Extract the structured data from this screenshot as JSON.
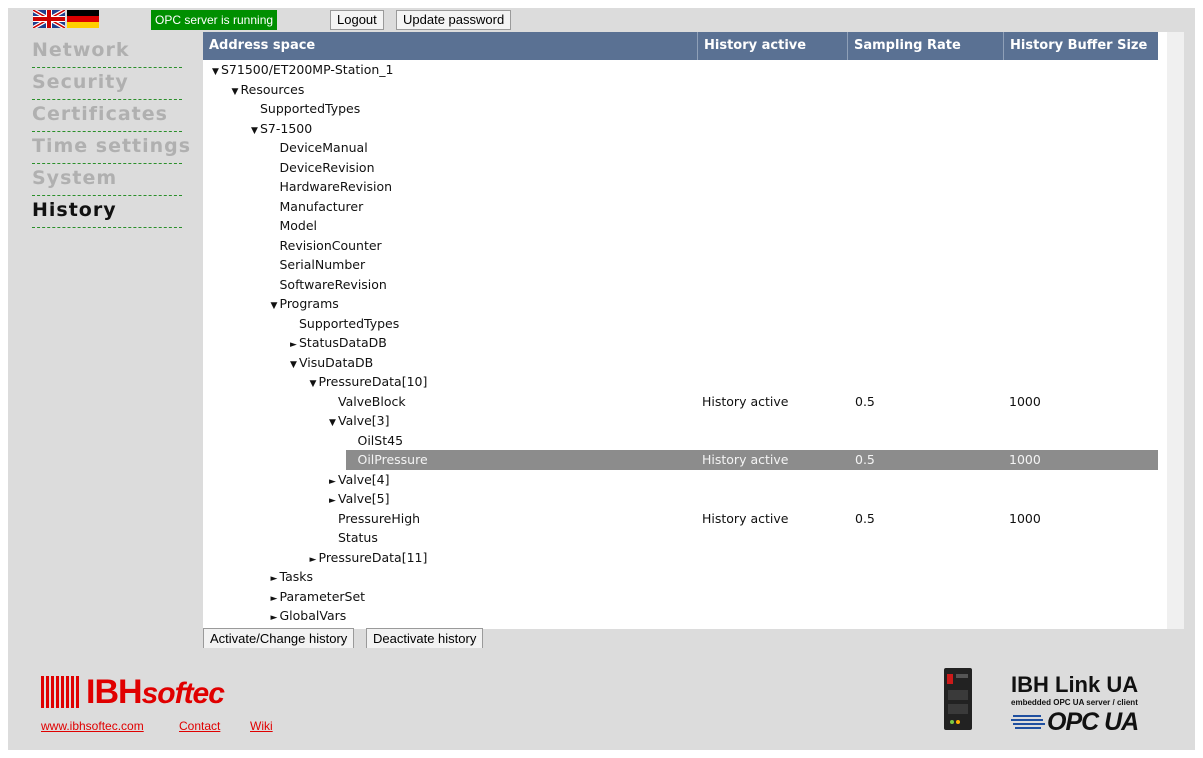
{
  "topbar": {
    "status": "OPC server is running",
    "logout_label": "Logout",
    "update_password_label": "Update password",
    "flags": [
      "uk-flag",
      "germany-flag"
    ]
  },
  "nav": {
    "items": [
      {
        "label": "Network",
        "active": false
      },
      {
        "label": "Security",
        "active": false
      },
      {
        "label": "Certificates",
        "active": false
      },
      {
        "label": "Time settings",
        "active": false
      },
      {
        "label": "System",
        "active": false
      },
      {
        "label": "History",
        "active": true
      }
    ]
  },
  "table": {
    "headers": {
      "address": "Address space",
      "history": "History active",
      "rate": "Sampling Rate",
      "buffer": "History Buffer Size"
    },
    "rows": [
      {
        "label": "S71500/ET200MP-Station_1",
        "level": 0,
        "toggle": "▼",
        "history": "",
        "rate": "",
        "buffer": "",
        "selected": false
      },
      {
        "label": "Resources",
        "level": 1,
        "toggle": "▼",
        "history": "",
        "rate": "",
        "buffer": "",
        "selected": false
      },
      {
        "label": "SupportedTypes",
        "level": 2,
        "toggle": "",
        "history": "",
        "rate": "",
        "buffer": "",
        "selected": false
      },
      {
        "label": "S7-1500",
        "level": 2,
        "toggle": "▼",
        "history": "",
        "rate": "",
        "buffer": "",
        "selected": false
      },
      {
        "label": "DeviceManual",
        "level": 3,
        "toggle": "",
        "history": "",
        "rate": "",
        "buffer": "",
        "selected": false
      },
      {
        "label": "DeviceRevision",
        "level": 3,
        "toggle": "",
        "history": "",
        "rate": "",
        "buffer": "",
        "selected": false
      },
      {
        "label": "HardwareRevision",
        "level": 3,
        "toggle": "",
        "history": "",
        "rate": "",
        "buffer": "",
        "selected": false
      },
      {
        "label": "Manufacturer",
        "level": 3,
        "toggle": "",
        "history": "",
        "rate": "",
        "buffer": "",
        "selected": false
      },
      {
        "label": "Model",
        "level": 3,
        "toggle": "",
        "history": "",
        "rate": "",
        "buffer": "",
        "selected": false
      },
      {
        "label": "RevisionCounter",
        "level": 3,
        "toggle": "",
        "history": "",
        "rate": "",
        "buffer": "",
        "selected": false
      },
      {
        "label": "SerialNumber",
        "level": 3,
        "toggle": "",
        "history": "",
        "rate": "",
        "buffer": "",
        "selected": false
      },
      {
        "label": "SoftwareRevision",
        "level": 3,
        "toggle": "",
        "history": "",
        "rate": "",
        "buffer": "",
        "selected": false
      },
      {
        "label": "Programs",
        "level": 3,
        "toggle": "▼",
        "history": "",
        "rate": "",
        "buffer": "",
        "selected": false
      },
      {
        "label": "SupportedTypes",
        "level": 4,
        "toggle": "",
        "history": "",
        "rate": "",
        "buffer": "",
        "selected": false
      },
      {
        "label": "StatusDataDB",
        "level": 4,
        "toggle": "►",
        "history": "",
        "rate": "",
        "buffer": "",
        "selected": false
      },
      {
        "label": "VisuDataDB",
        "level": 4,
        "toggle": "▼",
        "history": "",
        "rate": "",
        "buffer": "",
        "selected": false
      },
      {
        "label": "PressureData[10]",
        "level": 5,
        "toggle": "▼",
        "history": "",
        "rate": "",
        "buffer": "",
        "selected": false
      },
      {
        "label": "ValveBlock",
        "level": 6,
        "toggle": "",
        "history": "History active",
        "rate": "0.5",
        "buffer": "1000",
        "selected": false
      },
      {
        "label": "Valve[3]",
        "level": 6,
        "toggle": "▼",
        "history": "",
        "rate": "",
        "buffer": "",
        "selected": false
      },
      {
        "label": "OilSt45",
        "level": 7,
        "toggle": "",
        "history": "",
        "rate": "",
        "buffer": "",
        "selected": false
      },
      {
        "label": "OilPressure",
        "level": 7,
        "toggle": "",
        "history": "History active",
        "rate": "0.5",
        "buffer": "1000",
        "selected": true
      },
      {
        "label": "Valve[4]",
        "level": 6,
        "toggle": "►",
        "history": "",
        "rate": "",
        "buffer": "",
        "selected": false
      },
      {
        "label": "Valve[5]",
        "level": 6,
        "toggle": "►",
        "history": "",
        "rate": "",
        "buffer": "",
        "selected": false
      },
      {
        "label": "PressureHigh",
        "level": 6,
        "toggle": "",
        "history": "History active",
        "rate": "0.5",
        "buffer": "1000",
        "selected": false
      },
      {
        "label": "Status",
        "level": 6,
        "toggle": "",
        "history": "",
        "rate": "",
        "buffer": "",
        "selected": false
      },
      {
        "label": "PressureData[11]",
        "level": 5,
        "toggle": "►",
        "history": "",
        "rate": "",
        "buffer": "",
        "selected": false
      },
      {
        "label": "Tasks",
        "level": 3,
        "toggle": "►",
        "history": "",
        "rate": "",
        "buffer": "",
        "selected": false
      },
      {
        "label": "ParameterSet",
        "level": 3,
        "toggle": "►",
        "history": "",
        "rate": "",
        "buffer": "",
        "selected": false
      },
      {
        "label": "GlobalVars",
        "level": 3,
        "toggle": "►",
        "history": "",
        "rate": "",
        "buffer": "",
        "selected": false
      }
    ]
  },
  "actions": {
    "activate_label": "Activate/Change history",
    "deactivate_label": "Deactivate history"
  },
  "footer": {
    "brand_ibh": "IBH",
    "brand_softec": "softec",
    "links": {
      "www": "www.ibhsoftec.com",
      "contact": "Contact",
      "wiki": "Wiki"
    },
    "product_title": "IBH Link UA",
    "product_subtitle": "embedded OPC UA server / client",
    "opcua_logo_text": "OPC UA"
  },
  "colors": {
    "header_bg": "#5a7193",
    "status_green": "#008f00",
    "brand_red": "#e00000",
    "selected_row": "#8c8c8c",
    "nav_border": "#2a8f2a"
  }
}
